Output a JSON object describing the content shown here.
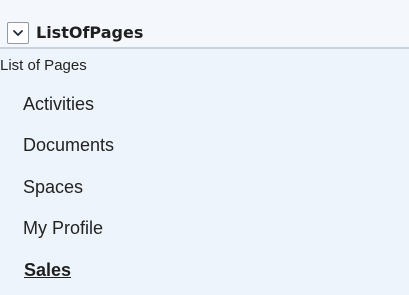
{
  "header": {
    "toggle_icon": "chevron-down-icon",
    "title": "ListOfPages"
  },
  "section": {
    "title": "List of Pages"
  },
  "nav": {
    "items": [
      {
        "label": "Activities",
        "selected": false
      },
      {
        "label": "Documents",
        "selected": false
      },
      {
        "label": "Spaces",
        "selected": false
      },
      {
        "label": "My Profile",
        "selected": false
      },
      {
        "label": "Sales",
        "selected": true
      }
    ]
  },
  "colors": {
    "panel_background": "#eef4fb",
    "header_divider": "#c8d3de",
    "text": "#222222"
  }
}
